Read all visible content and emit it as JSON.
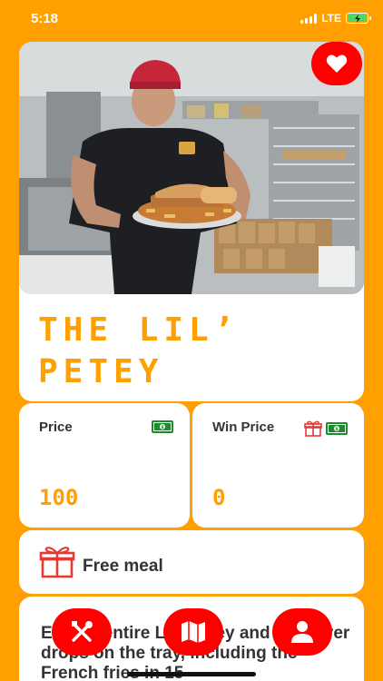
{
  "status_bar": {
    "time": "5:18",
    "network": "LTE"
  },
  "hero": {
    "photo_icon": "chef-with-sandwich-platter-photo",
    "favorite_icon": "heart-icon",
    "title": "The Lil’ Petey"
  },
  "stats": {
    "price": {
      "label": "Price",
      "value": "100",
      "icon": "cash-icon"
    },
    "win_price": {
      "label": "Win Price",
      "value": "0",
      "icons": [
        "gift-icon",
        "cash-icon"
      ]
    }
  },
  "reward": {
    "icon": "gift-icon",
    "label": "Free meal"
  },
  "description": {
    "text": "Eat the entire Lil'l Petey and whatever drops on the tray, including the French fries in 15"
  },
  "nav": {
    "items": [
      {
        "icon": "fork-knife-icon"
      },
      {
        "icon": "map-icon"
      },
      {
        "icon": "person-icon"
      }
    ]
  },
  "colors": {
    "background": "#FFA000",
    "accent_red": "#FF0000",
    "money_green": "#1E8C2E",
    "title_orange": "#FFA000"
  }
}
